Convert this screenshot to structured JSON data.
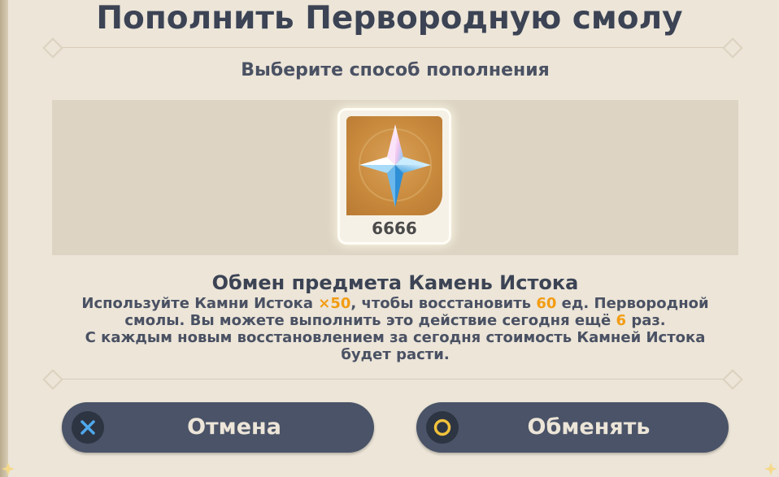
{
  "dialog": {
    "title": "Пополнить Первородную смолу",
    "subtitle": "Выберите способ пополнения"
  },
  "item": {
    "icon": "intertwined-fate-star-icon",
    "count": "6666"
  },
  "exchange": {
    "title": "Обмен предмета Камень Истока",
    "line1_a": "Используйте Камни Истока ",
    "line1_cost": "×50",
    "line1_b": ", чтобы восстановить ",
    "line1_amount": "60",
    "line1_c": " ед. Первородной",
    "line2_a": "смолы. Вы можете выполнить это действие сегодня ещё ",
    "line2_times": "6",
    "line2_b": " раз.",
    "line3": "С каждым новым восстановлением за сегодня стоимость Камней Истока",
    "line4": "будет расти."
  },
  "buttons": {
    "cancel_label": "Отмена",
    "cancel_icon": "cross-icon",
    "confirm_label": "Обменять",
    "confirm_icon": "circle-icon"
  },
  "colors": {
    "background": "#ece5d8",
    "highlight": "#f39c12",
    "button": "#4a5367",
    "text": "#3b4354"
  }
}
